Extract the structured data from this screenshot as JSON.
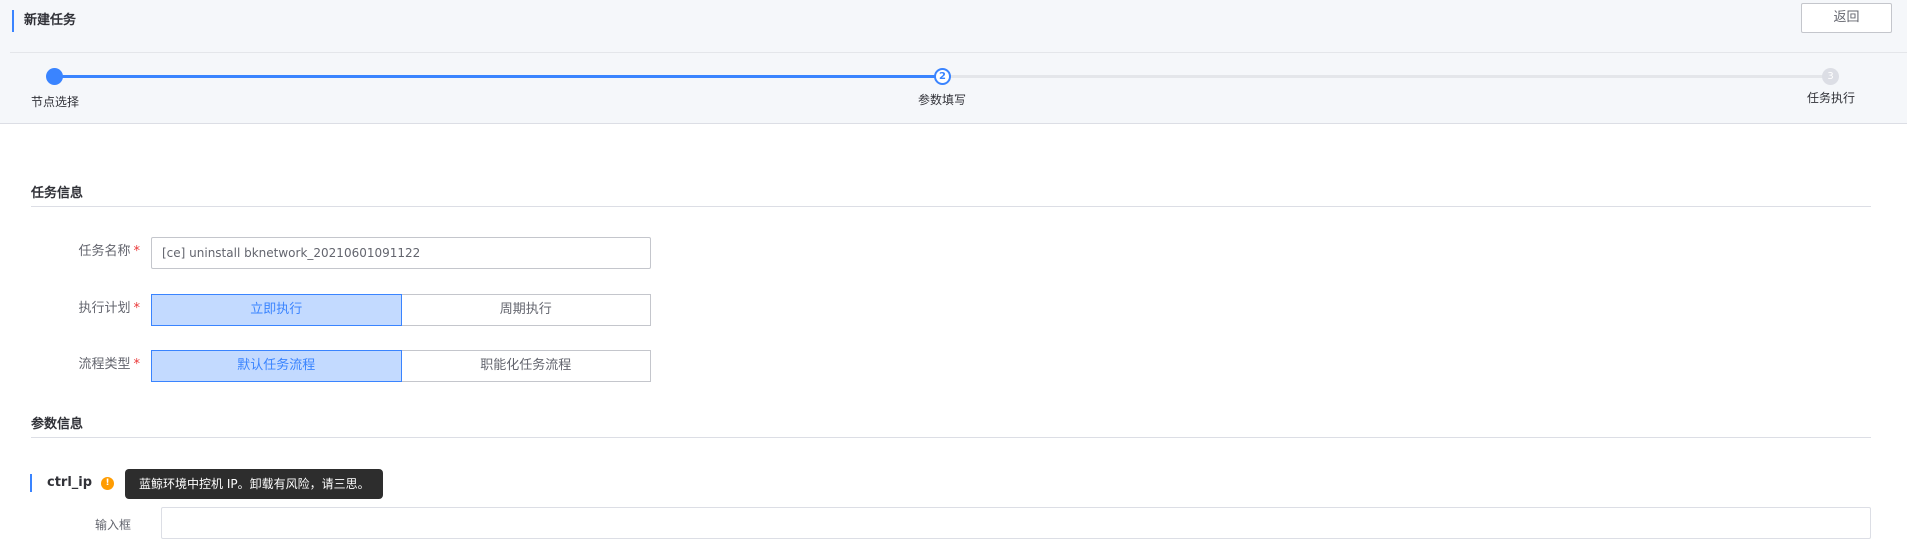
{
  "header": {
    "title": "新建任务",
    "back_label": "返回"
  },
  "steps": {
    "items": [
      {
        "label": "节点选择",
        "number": "",
        "state": "done"
      },
      {
        "label": "参数填写",
        "number": "2",
        "state": "current"
      },
      {
        "label": "任务执行",
        "number": "3",
        "state": "pending"
      }
    ]
  },
  "task_info": {
    "section_title": "任务信息",
    "name": {
      "label": "任务名称",
      "required_mark": "*",
      "value": "[ce] uninstall bknetwork_20210601091122"
    },
    "plan": {
      "label": "执行计划",
      "required_mark": "*",
      "options": [
        "立即执行",
        "周期执行"
      ],
      "selected": "立即执行"
    },
    "flow_type": {
      "label": "流程类型",
      "required_mark": "*",
      "options": [
        "默认任务流程",
        "职能化任务流程"
      ],
      "selected": "默认任务流程"
    }
  },
  "param_info": {
    "section_title": "参数信息",
    "param": {
      "name": "ctrl_ip",
      "info_icon": "info-icon",
      "tooltip": "蓝鲸环境中控机 IP。卸载有风险，请三思。",
      "input_label": "输入框",
      "input_value": ""
    }
  },
  "colors": {
    "primary": "#3a84ff",
    "required": "#ea3636",
    "warning": "#ff9c01"
  }
}
